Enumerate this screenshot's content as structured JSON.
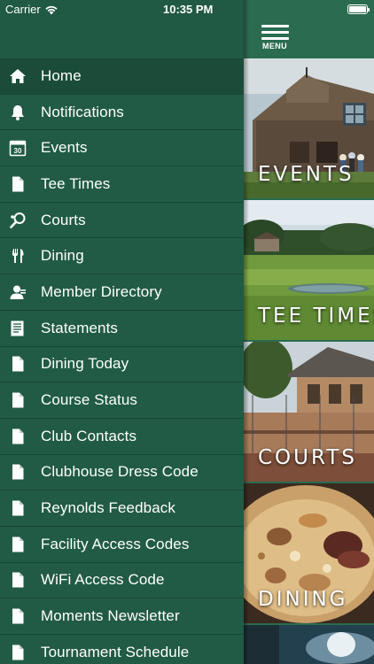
{
  "status_bar": {
    "carrier": "Carrier",
    "time": "10:35 PM"
  },
  "menu_button": {
    "label": "MENU"
  },
  "menu": {
    "items": [
      {
        "label": "Home",
        "icon": "home-icon",
        "active": true
      },
      {
        "label": "Notifications",
        "icon": "bell-icon"
      },
      {
        "label": "Events",
        "icon": "calendar-icon",
        "icon_text": "30"
      },
      {
        "label": "Tee Times",
        "icon": "document-icon"
      },
      {
        "label": "Courts",
        "icon": "tennis-racket-icon"
      },
      {
        "label": "Dining",
        "icon": "fork-knife-icon"
      },
      {
        "label": "Member Directory",
        "icon": "member-icon"
      },
      {
        "label": "Statements",
        "icon": "statement-icon"
      },
      {
        "label": "Dining Today",
        "icon": "document-icon"
      },
      {
        "label": "Course Status",
        "icon": "document-icon"
      },
      {
        "label": "Club Contacts",
        "icon": "document-icon"
      },
      {
        "label": "Clubhouse Dress Code",
        "icon": "document-icon"
      },
      {
        "label": "Reynolds Feedback",
        "icon": "document-icon"
      },
      {
        "label": "Facility Access Codes",
        "icon": "document-icon"
      },
      {
        "label": "WiFi Access Code",
        "icon": "document-icon"
      },
      {
        "label": "Moments Newsletter",
        "icon": "document-icon"
      },
      {
        "label": "Tournament Schedule",
        "icon": "document-icon"
      }
    ]
  },
  "tiles": {
    "events": "EVENTS",
    "tee_times": "TEE TIMES",
    "courts": "COURTS",
    "dining": "DINING"
  },
  "colors": {
    "drawer": "#215b45",
    "active_row": "#1a4c39",
    "divider": "#174634",
    "header": "#2b6c51"
  }
}
